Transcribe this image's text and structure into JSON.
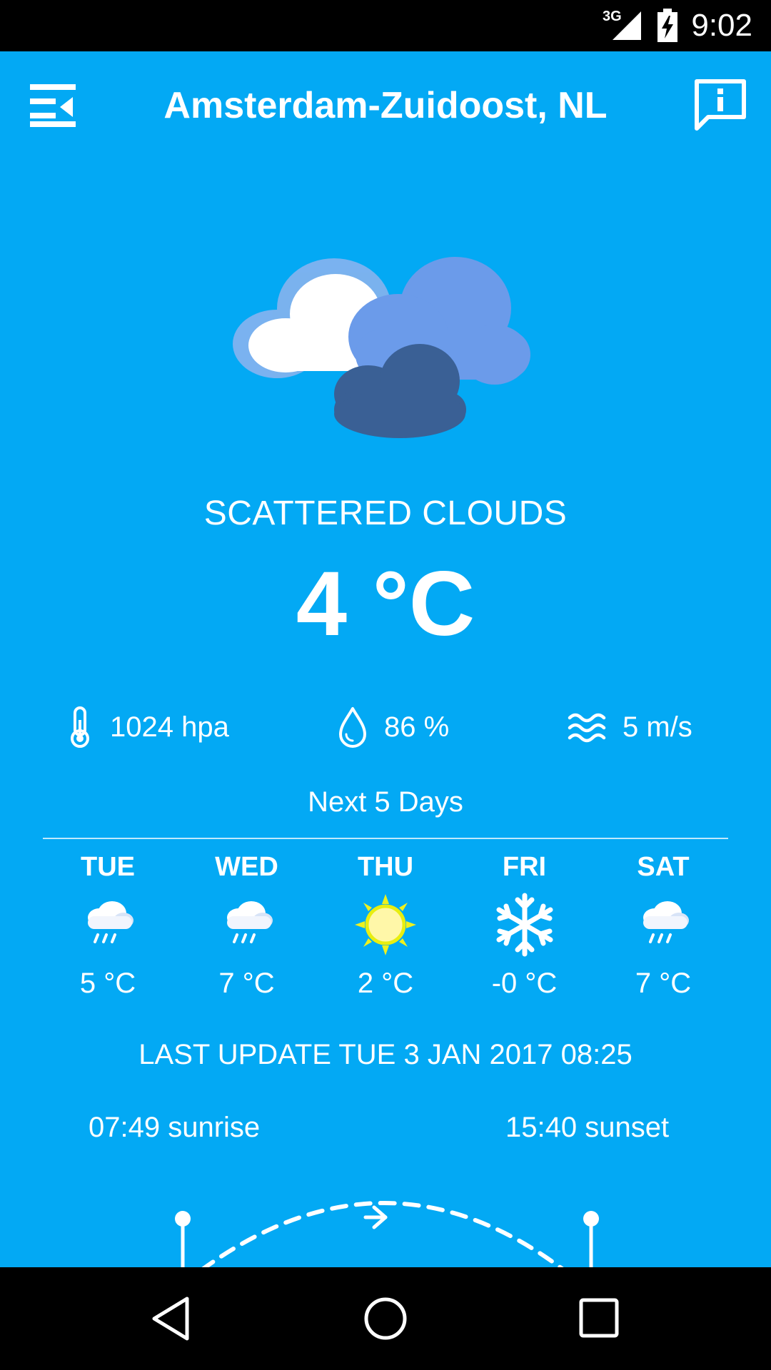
{
  "status_bar": {
    "network": "3G",
    "time": "9:02"
  },
  "header": {
    "city": "Amsterdam-Zuidoost, NL",
    "menu_icon": "menu-icon",
    "info_icon": "info-icon"
  },
  "current": {
    "condition": "SCATTERED CLOUDS",
    "temperature": "4 °C",
    "icon": "scattered-clouds-icon",
    "pressure": "1024 hpa",
    "humidity": "86 %",
    "wind": "5 m/s"
  },
  "forecast": {
    "title": "Next 5 Days",
    "days": [
      {
        "day": "TUE",
        "temp": "5 °C",
        "icon": "rain-cloud-icon"
      },
      {
        "day": "WED",
        "temp": "7 °C",
        "icon": "rain-cloud-icon"
      },
      {
        "day": "THU",
        "temp": "2 °C",
        "icon": "sun-icon"
      },
      {
        "day": "FRI",
        "temp": "-0 °C",
        "icon": "snowflake-icon"
      },
      {
        "day": "SAT",
        "temp": "7 °C",
        "icon": "rain-cloud-icon"
      }
    ]
  },
  "last_update": "LAST UPDATE TUE 3 JAN 2017 08:25",
  "sun": {
    "sunrise": "07:49 sunrise",
    "sunset": "15:40 sunset"
  },
  "colors": {
    "background": "#03A9F4",
    "text": "#FFFFFF",
    "bars": "#000000"
  }
}
